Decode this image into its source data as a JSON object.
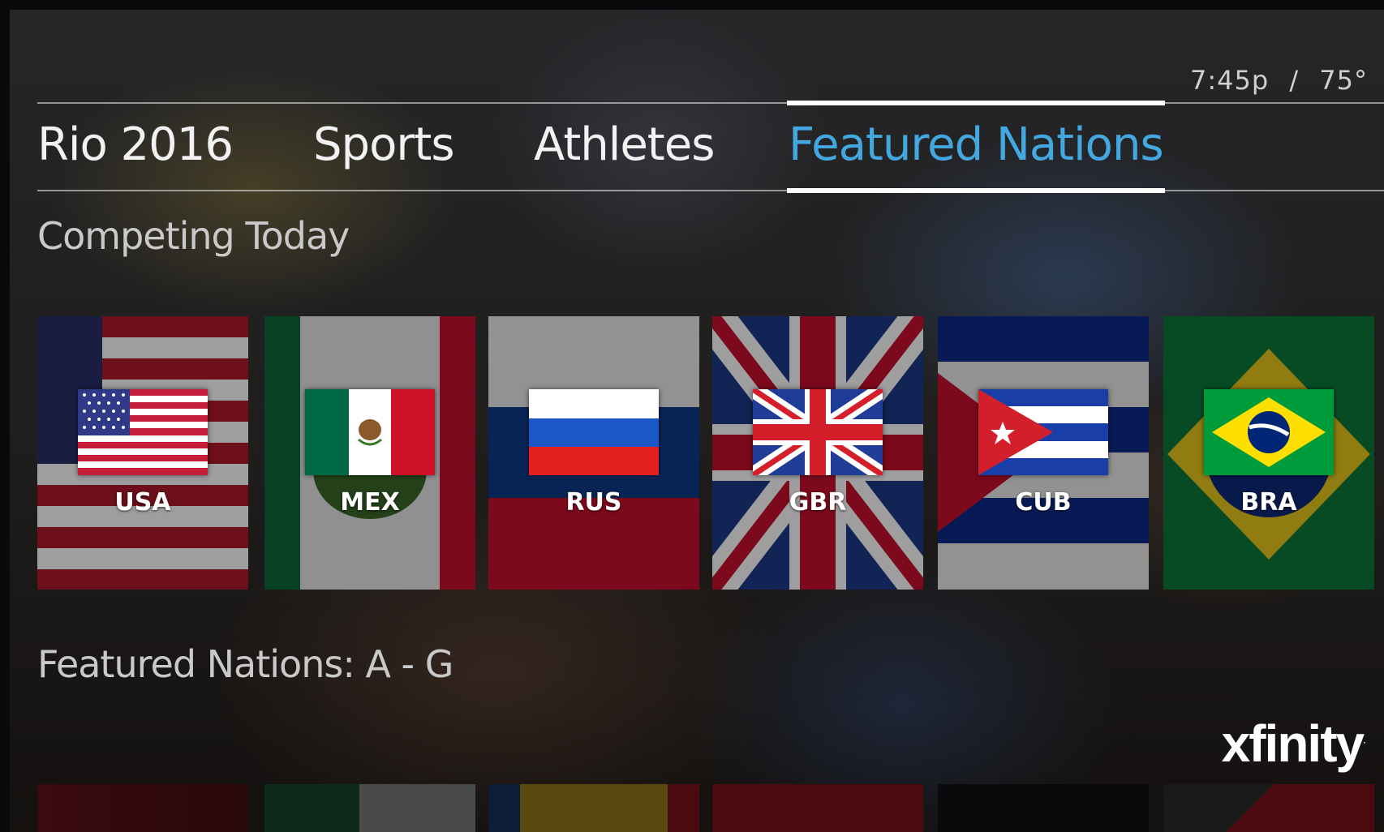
{
  "status": {
    "time": "7:45p",
    "separator": "/",
    "temperature": "75°"
  },
  "nav": {
    "tabs": [
      {
        "label": "Rio 2016",
        "active": false
      },
      {
        "label": "Sports",
        "active": false
      },
      {
        "label": "Athletes",
        "active": false
      },
      {
        "label": "Featured Nations",
        "active": true
      }
    ],
    "active_color": "#44a8e0"
  },
  "sections": {
    "competing_today": {
      "title": "Competing Today",
      "nations": [
        {
          "code": "USA",
          "flag": "usa-flag-icon"
        },
        {
          "code": "MEX",
          "flag": "mexico-flag-icon"
        },
        {
          "code": "RUS",
          "flag": "russia-flag-icon"
        },
        {
          "code": "GBR",
          "flag": "uk-flag-icon"
        },
        {
          "code": "CUB",
          "flag": "cuba-flag-icon"
        },
        {
          "code": "BRA",
          "flag": "brazil-flag-icon"
        }
      ]
    },
    "featured_nations": {
      "title": "Featured Nations: A - G"
    }
  },
  "brand": {
    "logo": "xfinity",
    "mark": "."
  }
}
